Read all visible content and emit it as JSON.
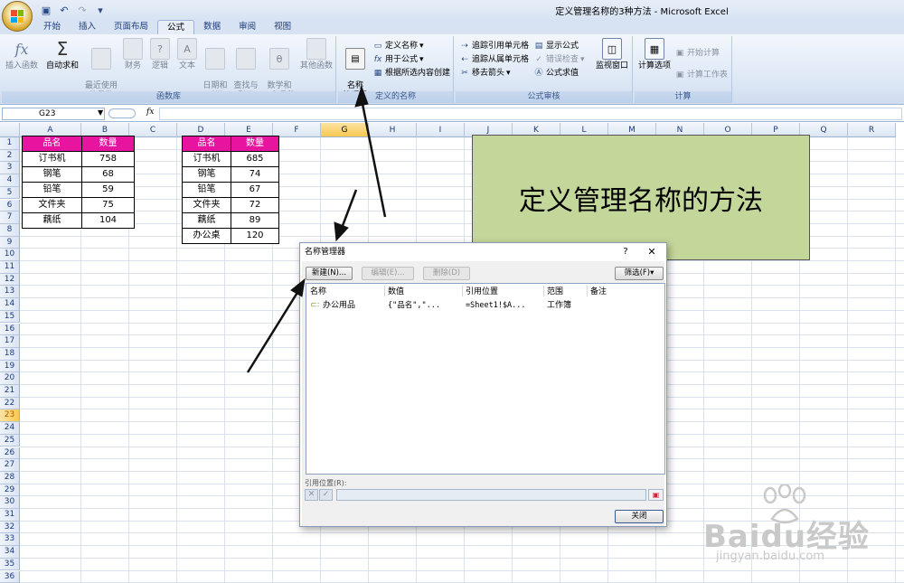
{
  "window": {
    "title": "定义管理名称的3种方法 - Microsoft Excel"
  },
  "tabs": [
    "开始",
    "插入",
    "页面布局",
    "公式",
    "数据",
    "审阅",
    "视图"
  ],
  "ribbon": {
    "function_library": {
      "label": "函数库",
      "insert_function": "插入函数",
      "autosum": "自动求和",
      "recent": "最近使用\n的函数",
      "financial": "财务",
      "logical": "逻辑",
      "text": "文本",
      "datetime": "日期和\n时间",
      "lookup": "查找与\n引用",
      "math": "数学和\n三角函数",
      "other": "其他函数"
    },
    "defined_names": {
      "label": "定义的名称",
      "name_manager": "名称\n管理器",
      "define_name": "定义名称",
      "use_in_formula": "用于公式",
      "create_from_selection": "根据所选内容创建"
    },
    "formula_auditing": {
      "label": "公式审核",
      "trace_precedents": "追踪引用单元格",
      "trace_dependents": "追踪从属单元格",
      "remove_arrows": "移去箭头",
      "show_formulas": "显示公式",
      "error_checking": "错误检查",
      "evaluate_formula": "公式求值",
      "watch_window": "监视窗口"
    },
    "calculation": {
      "label": "计算",
      "calc_options": "计算选项",
      "calc_now": "开始计算",
      "calc_sheet": "计算工作表"
    }
  },
  "formula_bar": {
    "name_box": "G23",
    "fx": "fx",
    "value": ""
  },
  "columns": [
    "A",
    "B",
    "C",
    "D",
    "E",
    "F",
    "G",
    "H",
    "I",
    "J",
    "K",
    "L",
    "M",
    "N",
    "O",
    "P",
    "Q",
    "R"
  ],
  "rows": [
    "1",
    "2",
    "3",
    "4",
    "5",
    "6",
    "7",
    "8",
    "9",
    "10",
    "11",
    "12",
    "13",
    "14",
    "15",
    "16",
    "17",
    "18",
    "19",
    "20",
    "21",
    "22",
    "23",
    "24",
    "25",
    "26",
    "27",
    "28",
    "29",
    "30",
    "31",
    "32",
    "33",
    "34",
    "35",
    "36"
  ],
  "table1": {
    "headers": [
      "品名",
      "数量"
    ],
    "rows": [
      [
        "订书机",
        "758"
      ],
      [
        "钢笔",
        "68"
      ],
      [
        "铅笔",
        "59"
      ],
      [
        "文件夹",
        "75"
      ],
      [
        "藕纸",
        "104"
      ]
    ]
  },
  "table2": {
    "headers": [
      "品名",
      "数量"
    ],
    "rows": [
      [
        "订书机",
        "685"
      ],
      [
        "钢笔",
        "74"
      ],
      [
        "铅笔",
        "67"
      ],
      [
        "文件夹",
        "72"
      ],
      [
        "藕纸",
        "89"
      ],
      [
        "办公桌",
        "120"
      ]
    ]
  },
  "banner": "定义管理名称的方法",
  "dialog": {
    "title": "名称管理器",
    "help": "?",
    "close": "✕",
    "btn_new": "新建(N)...",
    "btn_edit": "编辑(E)...",
    "btn_delete": "删除(D)",
    "btn_filter": "筛选(F)▾",
    "columns": [
      "名称",
      "数值",
      "引用位置",
      "范围",
      "备注"
    ],
    "entries": [
      {
        "name": "办公用品",
        "value": "{\"品名\",\"...",
        "ref": "=Sheet1!$A...",
        "scope": "工作簿",
        "note": ""
      }
    ],
    "ref_label": "引用位置(R):",
    "btn_close": "关闭"
  },
  "watermark": {
    "brand": "Baidu经验",
    "url": "jingyan.baidu.com"
  },
  "colors": {
    "header_fill": "#e6149f",
    "banner_fill": "#c4d79b",
    "selected_header": "#f8c94f"
  }
}
